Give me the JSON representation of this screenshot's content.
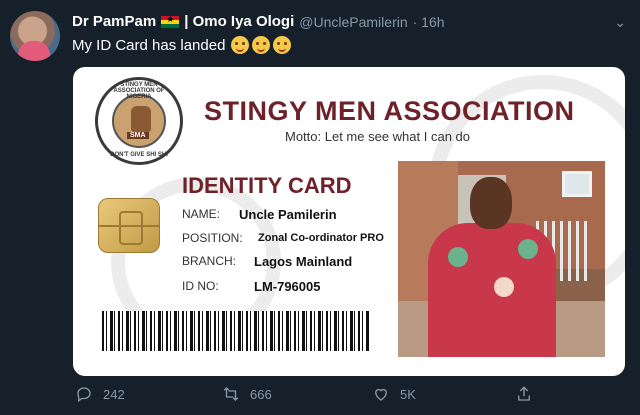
{
  "tweet": {
    "display_name": "Dr PamPam",
    "name_suffix": "| Omo Iya Ologi",
    "handle": "@UnclePamilerin",
    "time": "· 16h",
    "text": "My ID Card has landed"
  },
  "card": {
    "seal_tag": "SMA",
    "seal_ring_text": "STINGY MEN ASSOCIATION OF NIGERIA",
    "seal_bottom_text": "DON'T GIVE SHI SHI",
    "org_title": "STINGY MEN ASSOCIATION",
    "motto": "Motto: Let me see what I can do",
    "id_title": "IDENTITY CARD",
    "fields": [
      {
        "label": "NAME:",
        "value": "Uncle Pamilerin"
      },
      {
        "label": "POSITION:",
        "value": "Zonal Co-ordinator  PRO"
      },
      {
        "label": "BRANCH:",
        "value": "Lagos Mainland"
      },
      {
        "label": "ID NO:",
        "value": "LM-796005"
      }
    ]
  },
  "actions": {
    "reply_count": "242",
    "retweet_count": "666",
    "like_count": "5K"
  },
  "colors": {
    "background": "#15202b",
    "muted": "#8899a6",
    "card_title": "#6e2129"
  }
}
